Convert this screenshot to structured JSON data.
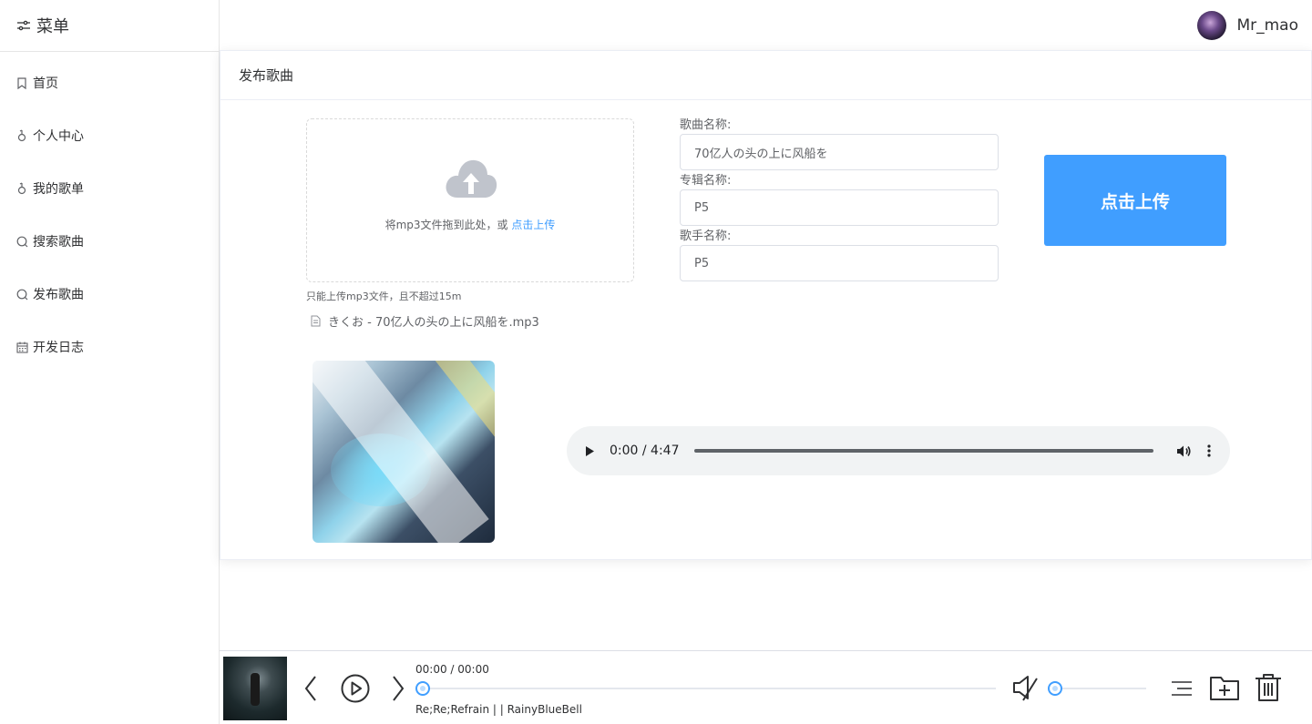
{
  "sidebar": {
    "title": "菜单",
    "items": [
      {
        "label": "首页",
        "icon": "bookmark-icon"
      },
      {
        "label": "个人中心",
        "icon": "user-icon"
      },
      {
        "label": "我的歌单",
        "icon": "user-icon"
      },
      {
        "label": "搜索歌曲",
        "icon": "search-icon"
      },
      {
        "label": "发布歌曲",
        "icon": "search-icon"
      },
      {
        "label": "开发日志",
        "icon": "calendar-icon"
      }
    ]
  },
  "header": {
    "username": "Mr_mao"
  },
  "card": {
    "title": "发布歌曲",
    "upload": {
      "text": "将mp3文件拖到此处，或",
      "link": "点击上传",
      "tip": "只能上传mp3文件，且不超过15m",
      "file_name": "きくお - 70亿人の头の上に风船を.mp3"
    },
    "form": {
      "song_name_label": "歌曲名称:",
      "song_name_value": "70亿人の头の上に风船を",
      "album_label": "专辑名称:",
      "album_value": "P5",
      "artist_label": "歌手名称:",
      "artist_value": "P5"
    },
    "submit_label": "点击上传",
    "audio": {
      "time": "0:00 / 4:47"
    }
  },
  "player": {
    "time": "00:00 / 00:00",
    "title": "Re;Re;Refrain | | RainyBlueBell",
    "progress": 0,
    "volume": 0
  },
  "colors": {
    "accent": "#409eff",
    "text": "#303133",
    "border": "#dcdfe6"
  }
}
